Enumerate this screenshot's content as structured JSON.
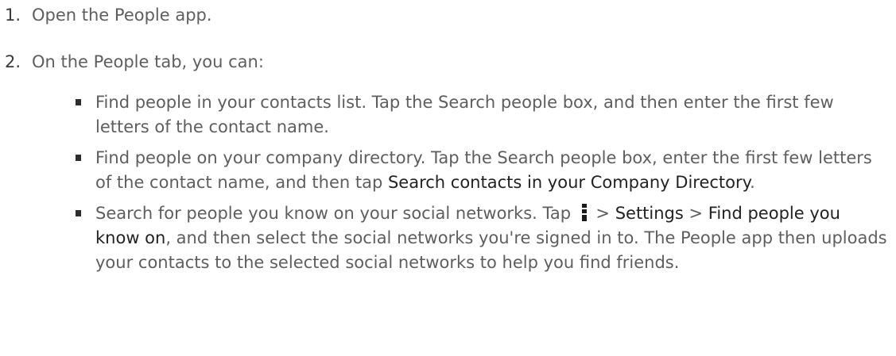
{
  "steps": [
    {
      "number": "1.",
      "text": "Open the People app."
    },
    {
      "number": "2.",
      "text": "On the People tab, you can:"
    }
  ],
  "bullets": {
    "item1": {
      "text": "Find people in your contacts list. Tap the Search people box, and then enter the first few letters of the contact name."
    },
    "item2": {
      "text_a": "Find people on your company directory. Tap the Search people box, enter the first few letters of the contact name, and then tap ",
      "strong_a": "Search contacts in your Company Directory",
      "text_b": "."
    },
    "item3": {
      "text_a": "Search for people you know on your social networks. Tap ",
      "icon": "more-vertical-icon",
      "text_b": " > ",
      "strong_a": "Settings",
      "text_c": " > ",
      "strong_b": "Find people you know on",
      "text_d": ", and then select the social networks you're signed in to. The People app then uploads your contacts to the selected social networks to help you find friends."
    }
  }
}
